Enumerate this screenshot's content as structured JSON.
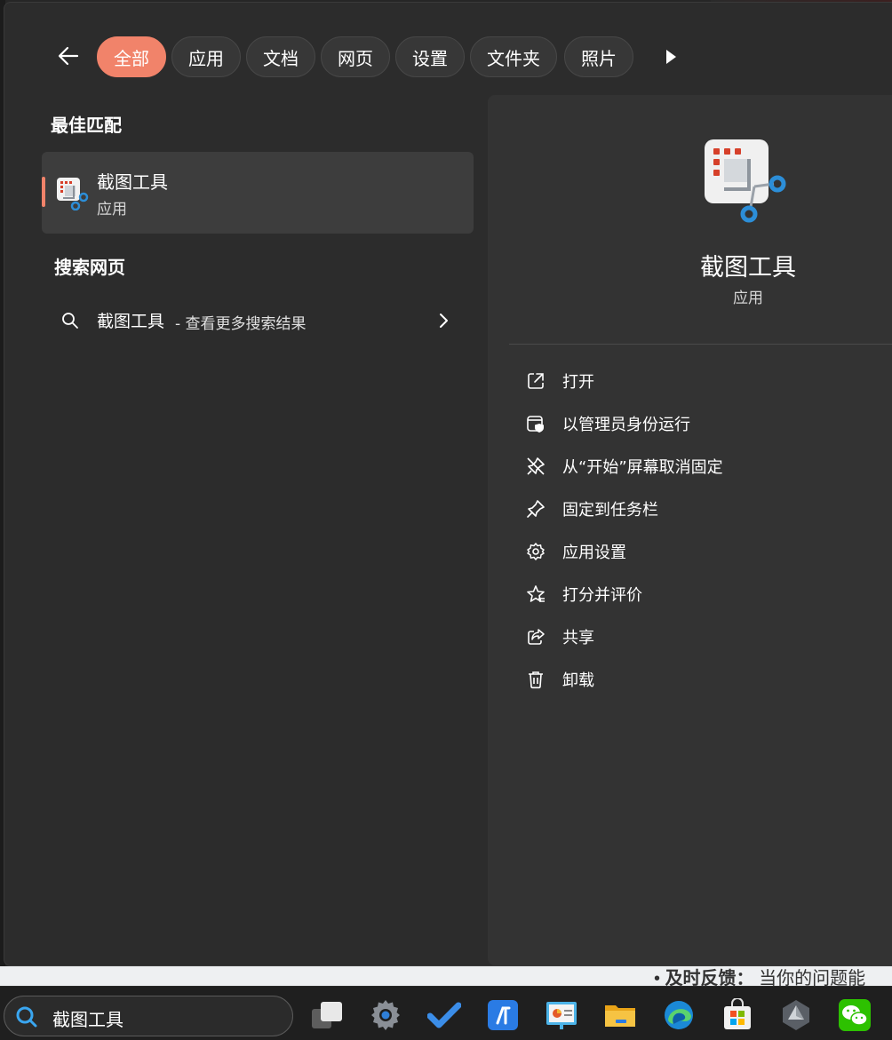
{
  "filters": {
    "back_icon": "arrow-left-icon",
    "chips": [
      "全部",
      "应用",
      "文档",
      "网页",
      "设置",
      "文件夹",
      "照片"
    ],
    "active_index": 0,
    "more_icon": "play-right-icon",
    "accent_color": "#f1836a"
  },
  "best_match": {
    "section_title": "最佳匹配",
    "app_name": "截图工具",
    "app_type": "应用",
    "icon": "snipping-tool-icon"
  },
  "web_search": {
    "section_title": "搜索网页",
    "term": "截图工具",
    "suffix": " - 查看更多搜索结果",
    "icon": "search-icon"
  },
  "detail": {
    "app_name": "截图工具",
    "app_type": "应用",
    "actions": [
      {
        "label": "打开",
        "icon": "open-external-icon"
      },
      {
        "label": "以管理员身份运行",
        "icon": "admin-shield-icon"
      },
      {
        "label": "从“开始”屏幕取消固定",
        "icon": "unpin-icon"
      },
      {
        "label": "固定到任务栏",
        "icon": "pin-icon"
      },
      {
        "label": "应用设置",
        "icon": "gear-icon"
      },
      {
        "label": "打分并评价",
        "icon": "star-rate-icon"
      },
      {
        "label": "共享",
        "icon": "share-icon"
      },
      {
        "label": "卸载",
        "icon": "trash-icon"
      }
    ]
  },
  "taskbar": {
    "search_value": "截图工具",
    "apps": [
      "task-view-icon",
      "settings-icon",
      "todo-icon",
      "app-blue-icon",
      "presentation-icon",
      "file-explorer-icon",
      "edge-icon",
      "store-icon",
      "unity-icon",
      "wechat-icon"
    ]
  },
  "background": {
    "bottom_label": "及时反馈：",
    "bottom_text": "当你的问题能"
  }
}
